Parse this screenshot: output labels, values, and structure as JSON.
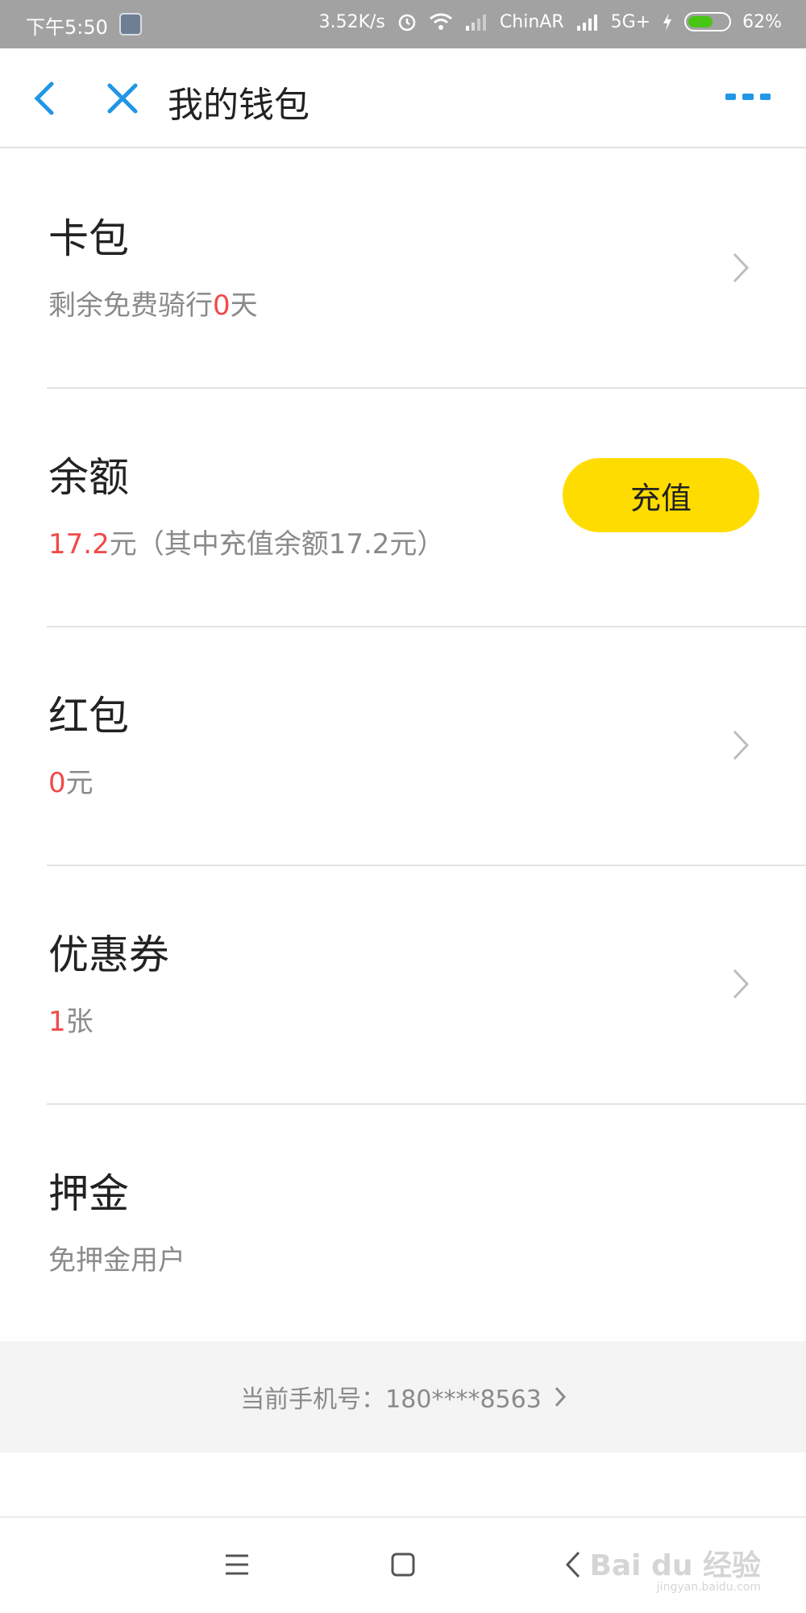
{
  "status_bar": {
    "time": "下午5:50",
    "speed": "3.52K/s",
    "carrier": "ChinAR",
    "network": "5G+",
    "battery": "62%",
    "battery_level": 0.62,
    "icons": [
      "alarm-icon",
      "wifi-icon",
      "signal-icon",
      "charging-icon"
    ]
  },
  "header": {
    "title": "我的钱包"
  },
  "sections": {
    "card_pack": {
      "title": "卡包",
      "sub_prefix": "剩余免费骑行",
      "sub_value": "0",
      "sub_suffix": "天"
    },
    "balance": {
      "title": "余额",
      "value": "17.2",
      "sub_suffix": "元（其中充值余额17.2元）",
      "button_label": "充值"
    },
    "red_packet": {
      "title": "红包",
      "value": "0",
      "sub_suffix": "元"
    },
    "coupon": {
      "title": "优惠券",
      "value": "1",
      "sub_suffix": "张"
    },
    "deposit": {
      "title": "押金",
      "sub": "免押金用户"
    }
  },
  "footer": {
    "phone_label": "当前手机号：180****8563"
  },
  "watermark": {
    "text": "Bai du 经验",
    "sub": "jingyan.baidu.com"
  },
  "colors": {
    "accent": "#2196e6",
    "highlight": "#f04a4a",
    "button": "#ffdc00",
    "status_bar": "#a2a2a2"
  }
}
